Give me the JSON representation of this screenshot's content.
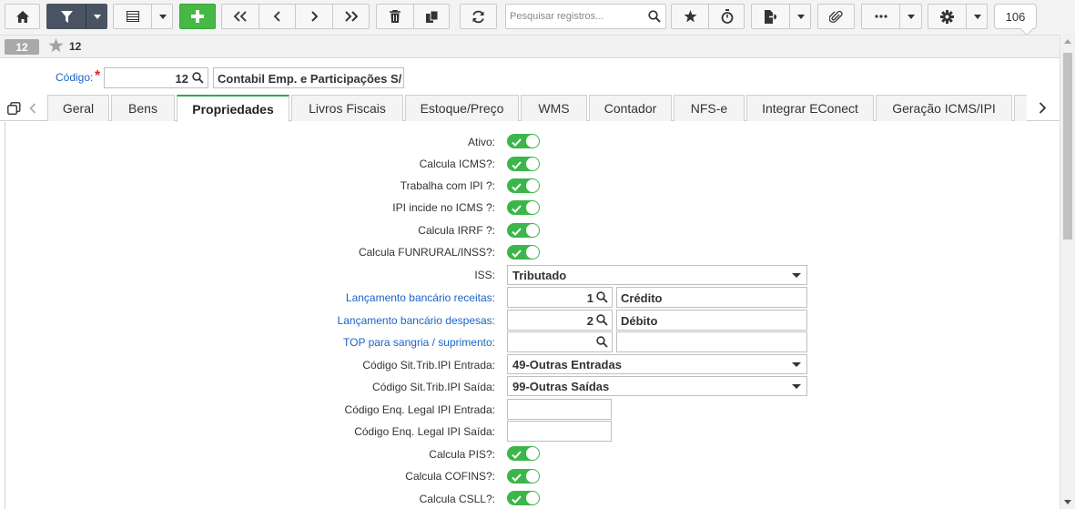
{
  "toolbar": {
    "search_placeholder": "Pesquisar registros...",
    "record_count": "106"
  },
  "record": {
    "badge": "12",
    "id": "12"
  },
  "header": {
    "code_label": "Código:",
    "required_mark": "*",
    "code_value": "12",
    "name_value": "Contabil Emp. e Participações S/"
  },
  "tabs": [
    {
      "label": "Geral"
    },
    {
      "label": "Bens"
    },
    {
      "label": "Propriedades",
      "active": true
    },
    {
      "label": "Livros Fiscais"
    },
    {
      "label": "Estoque/Preço"
    },
    {
      "label": "WMS"
    },
    {
      "label": "Contador"
    },
    {
      "label": "NFS-e"
    },
    {
      "label": "Integrar EConect"
    },
    {
      "label": "Geração ICMS/IPI"
    }
  ],
  "colors": {
    "toggle_on": "#3cb64a",
    "link": "#1a64c8",
    "active_tab_accent": "#2ea84f",
    "add_button": "#45b845",
    "filter_button": "#4a5361"
  },
  "fields": {
    "ativo": {
      "label": "Ativo:",
      "value": true
    },
    "calcula_icms": {
      "label": "Calcula ICMS?:",
      "value": true
    },
    "trabalha_ipi": {
      "label": "Trabalha com IPI ?:",
      "value": true
    },
    "ipi_incide_icms": {
      "label": "IPI incide no ICMS ?:",
      "value": true
    },
    "calcula_irrf": {
      "label": "Calcula IRRF ?:",
      "value": true
    },
    "calcula_funrural": {
      "label": "Calcula FUNRURAL/INSS?:",
      "value": true
    },
    "iss": {
      "label": "ISS:",
      "value": "Tributado"
    },
    "lanc_receitas": {
      "label": "Lançamento bancário receitas:",
      "code": "1",
      "desc": "Crédito"
    },
    "lanc_despesas": {
      "label": "Lançamento bancário despesas:",
      "code": "2",
      "desc": "Débito"
    },
    "top_sangria": {
      "label": "TOP para sangria / suprimento:",
      "code": "",
      "desc": ""
    },
    "sit_trib_entrada": {
      "label": "Código Sit.Trib.IPI Entrada:",
      "value": "49-Outras Entradas"
    },
    "sit_trib_saida": {
      "label": "Código Sit.Trib.IPI Saída:",
      "value": "99-Outras Saídas"
    },
    "enq_legal_entrada": {
      "label": "Código Enq. Legal IPI Entrada:",
      "value": ""
    },
    "enq_legal_saida": {
      "label": "Código Enq. Legal IPI Saída:",
      "value": ""
    },
    "calcula_pis": {
      "label": "Calcula PIS?:",
      "value": true
    },
    "calcula_cofins": {
      "label": "Calcula COFINS?:",
      "value": true
    },
    "calcula_csll": {
      "label": "Calcula CSLL?:",
      "value": true
    }
  }
}
